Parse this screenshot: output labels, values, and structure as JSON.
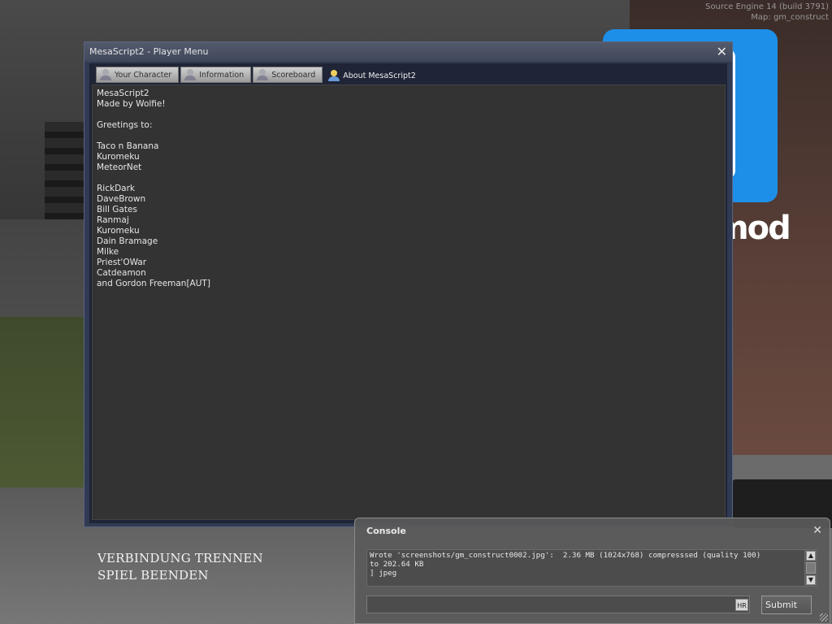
{
  "engine": {
    "line1": "Source Engine 14 (build 3791)",
    "line2": "Map: gm_construct"
  },
  "background": {
    "logo_text": "mod",
    "logo_color": "#1e8fe8"
  },
  "player_menu": {
    "title": "MesaScript2 - Player Menu",
    "close_glyph": "✕",
    "tabs": [
      {
        "label": "Your Character"
      },
      {
        "label": "Information"
      },
      {
        "label": "Scoreboard"
      },
      {
        "label": "About MesaScript2",
        "active": true
      }
    ],
    "about_lines": [
      "MesaScript2",
      "Made by Wolfie!",
      "",
      "Greetings to:",
      "",
      "Taco n Banana",
      "Kuromeku",
      "MeteorNet",
      "",
      "RickDark",
      "DaveBrown",
      "Bill Gates",
      "Ranmaj",
      "Kuromeku",
      "Dain Bramage",
      "Milke",
      "Priest'OWar",
      "Catdeamon",
      "and Gordon Freeman[AUT]"
    ]
  },
  "main_menu": {
    "disconnect": "VERBINDUNG TRENNEN",
    "quit": "SPIEL BEENDEN"
  },
  "console": {
    "title": "Console",
    "close_glyph": "✕",
    "log_lines": [
      "Wrote 'screenshots/gm_construct0002.jpg':  2.36 MB (1024x768) compresssed (quality 100)",
      "to 202.64 KB",
      "] jpeg"
    ],
    "input_value": "",
    "hr_badge": "HR",
    "submit_label": "Submit",
    "scroll_up_glyph": "▲",
    "scroll_down_glyph": "▼"
  }
}
